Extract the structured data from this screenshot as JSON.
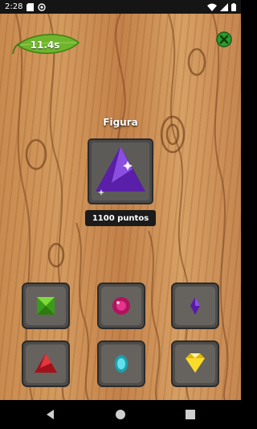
{
  "status_bar": {
    "time": "2:28",
    "icons": [
      "sd-card-icon",
      "no-signal-icon",
      "wifi-icon",
      "signal-icon",
      "battery-icon"
    ]
  },
  "game": {
    "timer": "11.4s",
    "figure_label": "Figura",
    "target_gem": "purple-triangle-gem-icon",
    "points_label": "1100 puntos",
    "close_icon": "close-icon",
    "options": [
      {
        "name": "green-square-gem-icon",
        "color": "#5cc52b"
      },
      {
        "name": "pink-round-gem-icon",
        "color": "#d8237a"
      },
      {
        "name": "purple-small-gem-icon",
        "color": "#6a22b8"
      },
      {
        "name": "red-triangle-gem-icon",
        "color": "#c81e1e"
      },
      {
        "name": "cyan-oval-gem-icon",
        "color": "#3bc9d6"
      },
      {
        "name": "yellow-diamond-gem-icon",
        "color": "#f4d21c"
      }
    ]
  },
  "nav": {
    "buttons": [
      "back-icon",
      "home-icon",
      "recents-icon"
    ]
  }
}
